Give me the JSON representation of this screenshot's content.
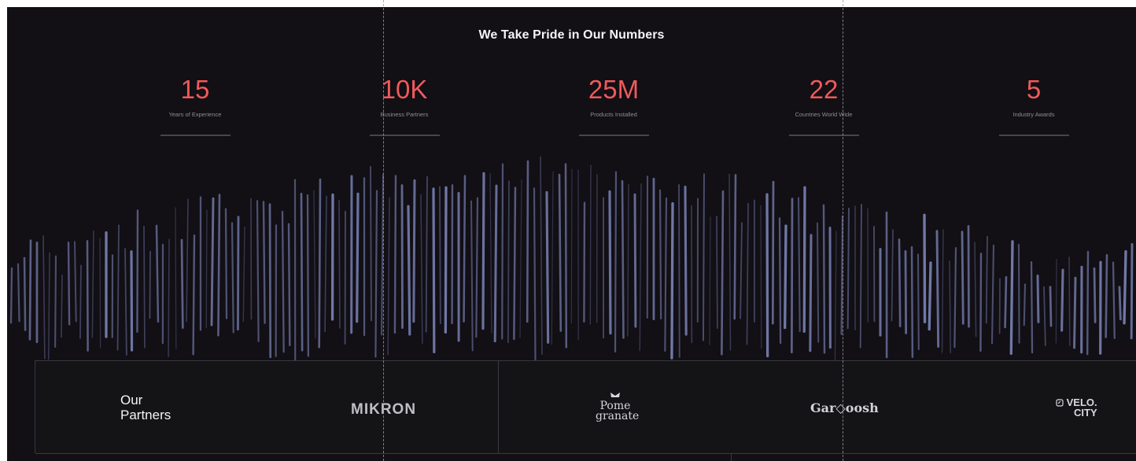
{
  "heading": "We Take Pride in Our Numbers",
  "stats": [
    {
      "value": "15",
      "label": "Years of Experience"
    },
    {
      "value": "10K",
      "label": "Business Partners"
    },
    {
      "value": "25M",
      "label": "Products Installed"
    },
    {
      "value": "22",
      "label": "Countries World Wide"
    },
    {
      "value": "5",
      "label": "Industry Awards"
    }
  ],
  "partners": {
    "title_line1": "Our",
    "title_line2": "Partners",
    "logos": [
      {
        "name": "MIKRON",
        "icon": "mikron-logo"
      },
      {
        "name_line1": "Pome",
        "name_line2": "granate",
        "icon": "pomegranate-logo"
      },
      {
        "name": "Gar◇oosh",
        "icon": "garnoosh-logo"
      },
      {
        "name_line1": "VELO.",
        "name_line2": "CITY",
        "icon": "velocity-logo"
      }
    ]
  },
  "colors": {
    "background": "#120f15",
    "accent": "#ef5a5a",
    "streaks": "#8a96cf"
  }
}
